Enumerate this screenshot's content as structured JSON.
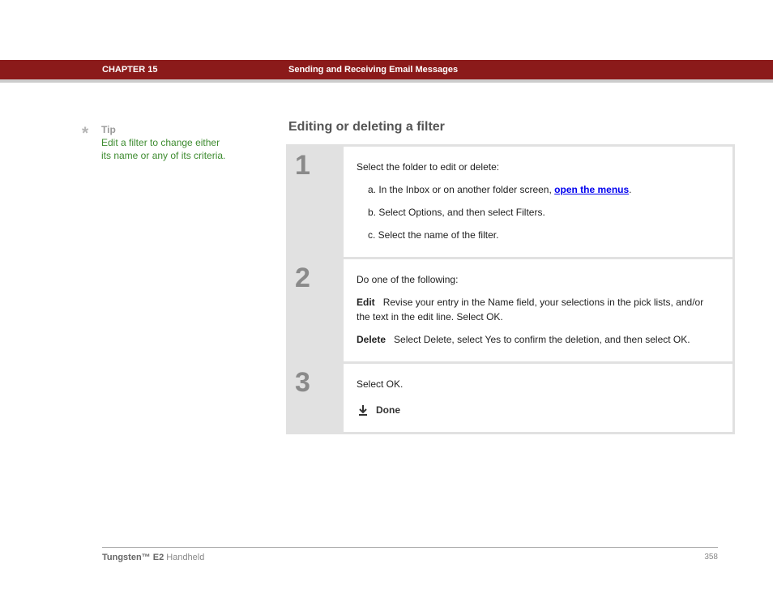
{
  "header": {
    "chapter": "CHAPTER 15",
    "subtitle": "Sending and Receiving Email Messages"
  },
  "tip": {
    "asterisk": "*",
    "label": "Tip",
    "text": "Edit a filter to change either its name or any of its criteria."
  },
  "section": {
    "title": "Editing or deleting a filter"
  },
  "steps": [
    {
      "num": "1",
      "intro": "Select the folder to edit or delete:",
      "items": [
        {
          "prefix": "a.  In the Inbox or on another folder screen, ",
          "link": "open the menus",
          "suffix": "."
        },
        {
          "text": "b.  Select Options, and then select Filters."
        },
        {
          "text": "c.  Select the name of the filter."
        }
      ]
    },
    {
      "num": "2",
      "intro": "Do one of the following:",
      "defs": [
        {
          "term": "Edit",
          "desc": "Revise your entry in the Name field, your selections in the pick lists, and/or the text in the edit line. Select OK."
        },
        {
          "term": "Delete",
          "desc": "Select Delete, select Yes to confirm the deletion, and then select OK."
        }
      ]
    },
    {
      "num": "3",
      "intro": "Select OK.",
      "done": "Done"
    }
  ],
  "footer": {
    "product_bold": "Tungsten™ E2",
    "product_rest": " Handheld",
    "page": "358"
  }
}
